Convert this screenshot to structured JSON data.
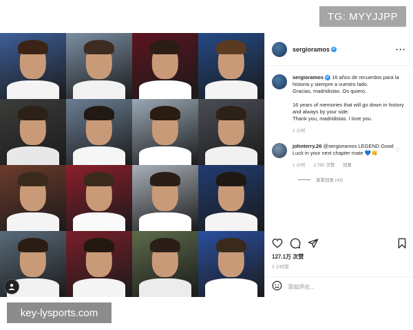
{
  "watermarks": {
    "top": "TG: MYYJJPP",
    "bottom": "key-lysports.com"
  },
  "grid": {
    "tiles": [
      {
        "bg": "#3d5f98",
        "shirt": "#f4f4f4",
        "hair": "#3b2415"
      },
      {
        "bg": "#7c8ea2",
        "shirt": "#f2f2f2",
        "hair": "#3d2c22"
      },
      {
        "bg": "#5c1420",
        "shirt": "#ffffff",
        "hair": "#2b1d14"
      },
      {
        "bg": "#244a86",
        "shirt": "#f4f4f4",
        "hair": "#5a3b22"
      },
      {
        "bg": "#3b3d3a",
        "shirt": "#e8e8e8",
        "hair": "#2c2018"
      },
      {
        "bg": "#6b7e93",
        "shirt": "#f6f6f6",
        "hair": "#231914"
      },
      {
        "bg": "#9aa8b4",
        "shirt": "#ffffff",
        "hair": "#2a1c12"
      },
      {
        "bg": "#4a4d55",
        "shirt": "#f0f0f0",
        "hair": "#2d2118"
      },
      {
        "bg": "#6d3b2c",
        "shirt": "#f4f4f4",
        "hair": "#3a2a1c"
      },
      {
        "bg": "#8c1e2c",
        "shirt": "#fafafa",
        "hair": "#3a2a1c"
      },
      {
        "bg": "#a9b0b8",
        "shirt": "#ffffff",
        "hair": "#2a1e16"
      },
      {
        "bg": "#213c72",
        "shirt": "#f4f4f4",
        "hair": "#1f1812"
      },
      {
        "bg": "#596a79",
        "shirt": "#f2f2f2",
        "hair": "#2b1d14"
      },
      {
        "bg": "#7a1e2a",
        "shirt": "#f4f4f4",
        "hair": "#241812"
      },
      {
        "bg": "#5d6b4a",
        "shirt": "#ececec",
        "hair": "#2a1e16"
      },
      {
        "bg": "#2a4fa0",
        "shirt": "#ffffff",
        "hair": "#3a2a1c"
      }
    ]
  },
  "post": {
    "username": "sergioramos",
    "verified_mark": "✔",
    "more_label": "···",
    "caption": {
      "username": "sergioramos",
      "lines": [
        "16 años de recuerdos para la historia y siempre a vuestro lado.",
        "Gracias, madridistas. Os quiero.",
        "16 years of memories that will go down in history and always by your side.",
        "Thank you, madridistas. I love you."
      ],
      "time": "1 小时"
    },
    "comment": {
      "username": "johnterry.26",
      "mention": "@sergioramos",
      "text": "LEGEND Good Luck in your next chapter mate 💙👊",
      "time": "1 小时",
      "likes": "2,782 次赞",
      "reply": "回复",
      "heart": "♡"
    },
    "view_replies": "查看回复 (43)",
    "likes": "127.1万 次赞",
    "timestamp": "1 小时前",
    "add_comment_placeholder": "添加评论..."
  },
  "icons": {
    "heart": "heart-icon",
    "comment": "comment-icon",
    "share": "share-icon",
    "save": "bookmark-icon",
    "emoji": "emoji-icon",
    "more": "more-icon"
  }
}
